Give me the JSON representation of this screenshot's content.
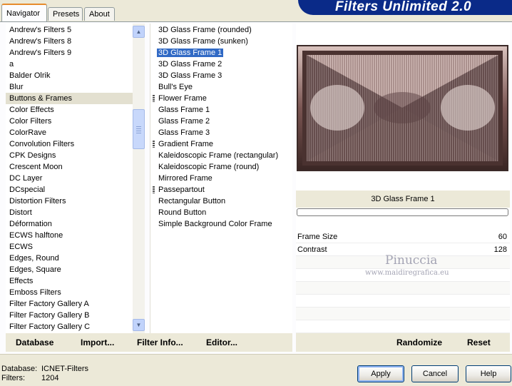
{
  "app_title": "Filters Unlimited 2.0",
  "tabs": [
    {
      "label": "Navigator",
      "active": true
    },
    {
      "label": "Presets",
      "active": false
    },
    {
      "label": "About",
      "active": false
    }
  ],
  "categories": {
    "items": [
      "Andrew's Filters 5",
      "Andrew's Filters 8",
      "Andrew's Filters 9",
      "a",
      "Balder Olrik",
      "Blur",
      "Buttons & Frames",
      "Color Effects",
      "Color Filters",
      "ColorRave",
      "Convolution Filters",
      "CPK Designs",
      "Crescent Moon",
      "DC Layer",
      "DCspecial",
      "Distortion Filters",
      "Distort",
      "Déformation",
      "ECWS halftone",
      "ECWS",
      "Edges, Round",
      "Edges, Square",
      "Effects",
      "Emboss Filters",
      "Filter Factory Gallery A",
      "Filter Factory Gallery B",
      "Filter Factory Gallery C"
    ],
    "selected": "Buttons & Frames"
  },
  "filters": {
    "items": [
      "3D Glass Frame (rounded)",
      "3D Glass Frame (sunken)",
      "3D Glass Frame 1",
      "3D Glass Frame 2",
      "3D Glass Frame 3",
      "Bull's Eye",
      "Flower Frame",
      "Glass Frame 1",
      "Glass Frame 2",
      "Glass Frame 3",
      "Gradient Frame",
      "Kaleidoscopic Frame (rectangular)",
      "Kaleidoscopic Frame (round)",
      "Mirrored Frame",
      "Passepartout",
      "Rectangular Button",
      "Round Button",
      "Simple Background Color Frame"
    ],
    "marked": [
      "Flower Frame",
      "Gradient Frame",
      "Passepartout"
    ],
    "selected": "3D Glass Frame 1"
  },
  "bottom_left_buttons": {
    "database": "Database",
    "import": "Import...",
    "filter_info": "Filter Info...",
    "editor": "Editor..."
  },
  "preview": {
    "filter_name": "3D Glass Frame 1"
  },
  "params": [
    {
      "name": "Frame Size",
      "value": "60"
    },
    {
      "name": "Contrast",
      "value": "128"
    }
  ],
  "watermark": {
    "line1": "Pinuccia",
    "line2": "www.maidiregrafica.eu"
  },
  "bottom_right_buttons": {
    "randomize": "Randomize",
    "reset": "Reset"
  },
  "status": {
    "database_label": "Database:",
    "database_value": "ICNET-Filters",
    "filters_label": "Filters:",
    "filters_value": "1204"
  },
  "dialog_buttons": {
    "apply": "Apply",
    "cancel": "Cancel",
    "help": "Help"
  },
  "colors": {
    "banner": "#0a2a88",
    "selection": "#316ac5",
    "tab_accent": "#e68b2c"
  }
}
